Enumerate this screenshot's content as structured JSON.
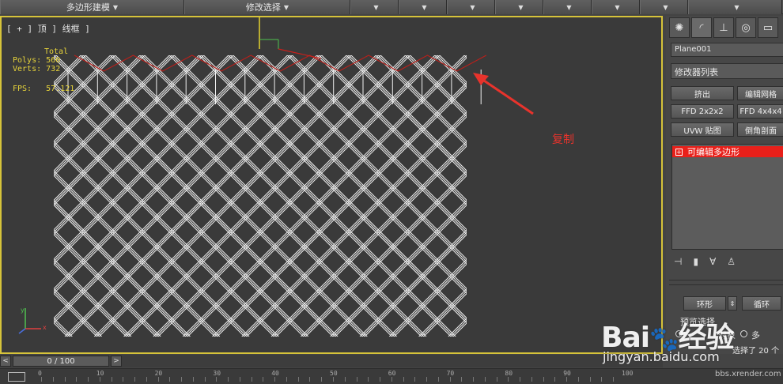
{
  "ribbon": {
    "menu1": "多边形建模",
    "menu2": "修改选择"
  },
  "viewport": {
    "label": "[ + ] 顶 ] 线框 ]",
    "stats": {
      "total_label": "Total",
      "polys_label": "Polys:",
      "polys_value": "560",
      "verts_label": "Verts:",
      "verts_value": "732",
      "fps_label": "FPS:",
      "fps_value": "57.121"
    },
    "annotation": "复制",
    "axis_y": "y",
    "axis_x": "x",
    "colors": {
      "mesh": "#f2f2f2",
      "edge_red": "#b8201b",
      "arrow": "#e8332c",
      "border": "#d6c33a"
    }
  },
  "panel": {
    "object_name": "Plane001",
    "modifier_list": "修改器列表",
    "buttons": {
      "extrude": "挤出",
      "edit_mesh": "编辑网格",
      "ffd_2": "FFD 2x2x2",
      "ffd_4": "FFD 4x4x4",
      "uvw": "UVW 贴图",
      "bevel": "倒角剖面"
    },
    "stack_item": "可编辑多边形",
    "ring_label": "环形",
    "loop_label": "循环",
    "preview_label": "预览选择",
    "obj_label": "对象",
    "multi_label": "多",
    "selected_label": "选择了 20 个"
  },
  "timeline": {
    "position": "0 / 100",
    "prev": "<",
    "next": ">",
    "ticks": [
      "0",
      "10",
      "20",
      "30",
      "40",
      "50",
      "60",
      "70",
      "80",
      "90",
      "100"
    ]
  },
  "watermark": {
    "logo": "Bai百度",
    "url": "jingyan.baidu.com",
    "sub": "bbs.xrender.com"
  }
}
